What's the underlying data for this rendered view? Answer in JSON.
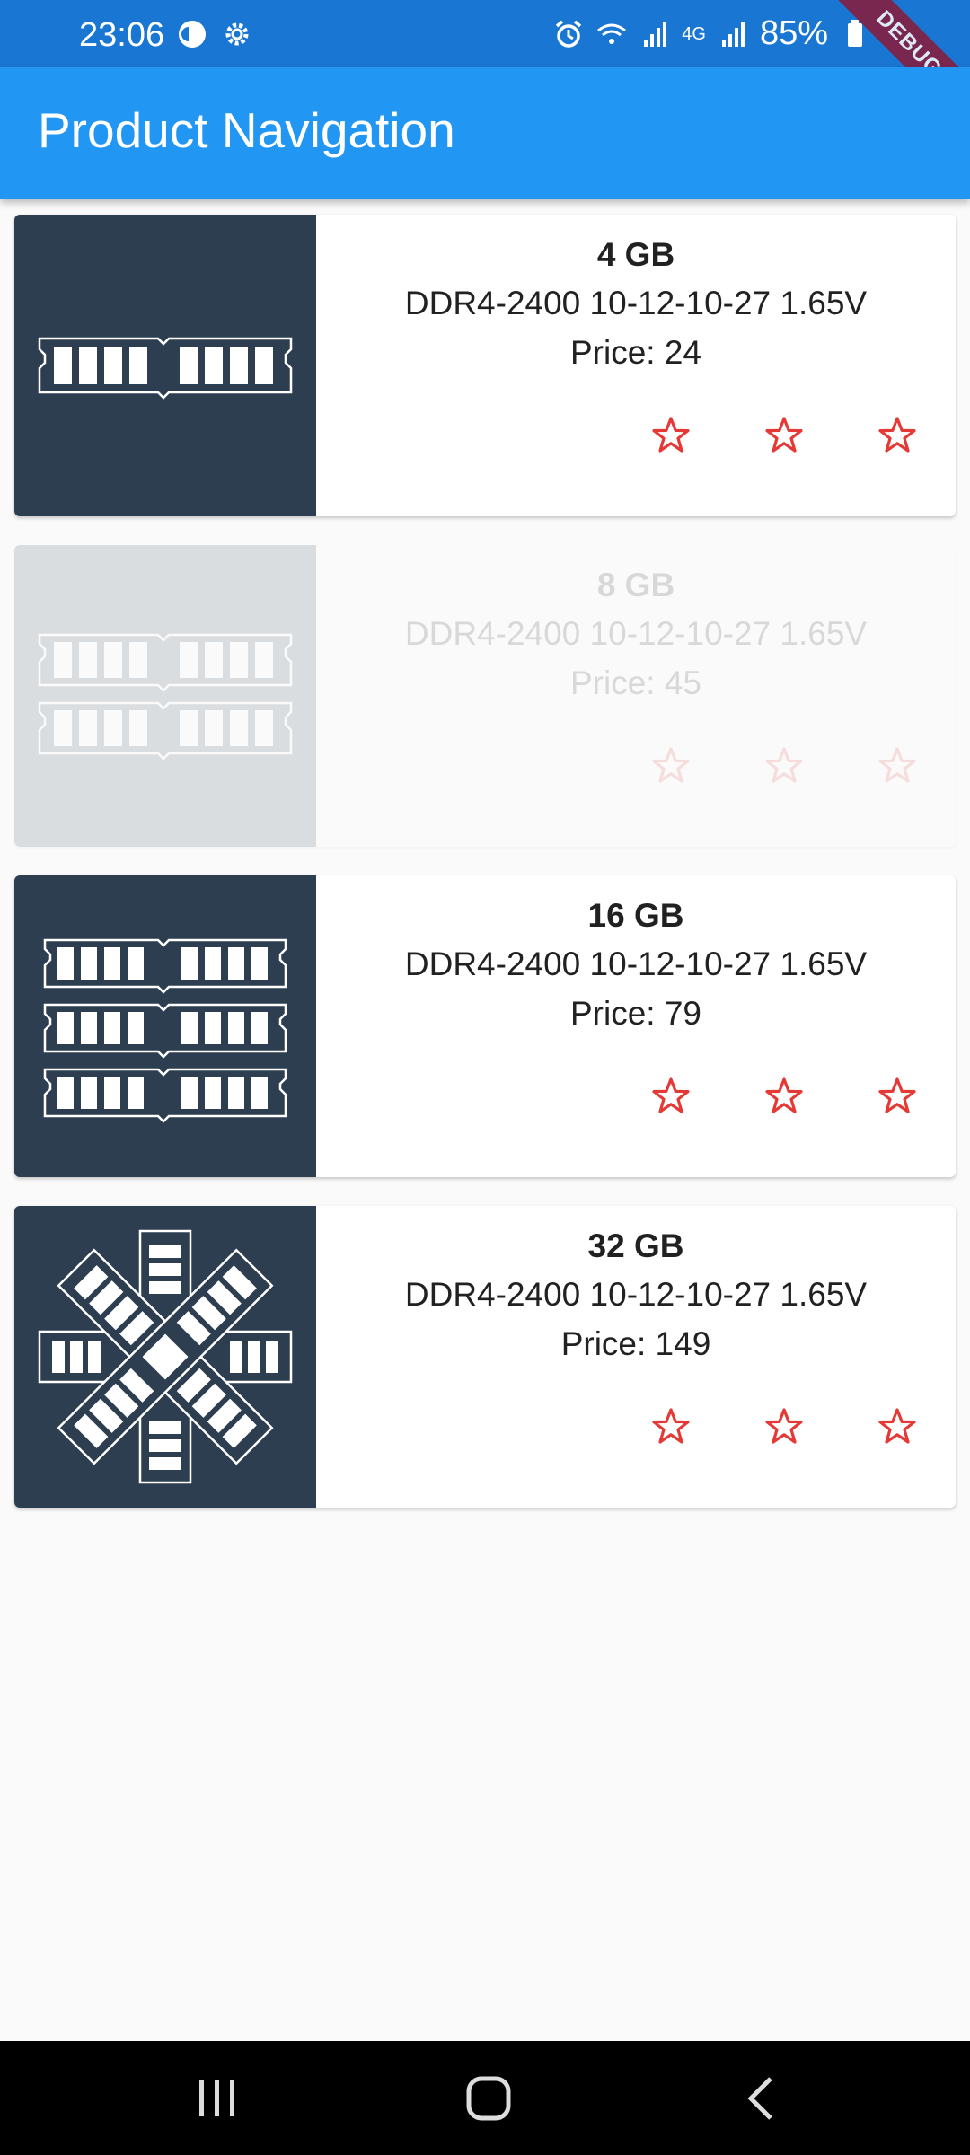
{
  "status": {
    "time": "23:06",
    "battery": "85%",
    "network": "4G",
    "debug_label": "DEBUG"
  },
  "app_bar": {
    "title": "Product Navigation"
  },
  "products": [
    {
      "capacity": "4 GB",
      "spec": "DDR4-2400 10-12-10-27 1.65V",
      "price": "Price: 24",
      "image": "single-ram-module-icon",
      "enabled": true,
      "rating_max": 3
    },
    {
      "capacity": "8 GB",
      "spec": "DDR4-2400 10-12-10-27 1.65V",
      "price": "Price: 45",
      "image": "double-ram-module-icon",
      "enabled": false,
      "rating_max": 3
    },
    {
      "capacity": "16 GB",
      "spec": "DDR4-2400 10-12-10-27 1.65V",
      "price": "Price: 79",
      "image": "triple-ram-module-icon",
      "enabled": true,
      "rating_max": 3
    },
    {
      "capacity": "32 GB",
      "spec": "DDR4-2400 10-12-10-27 1.65V",
      "price": "Price: 149",
      "image": "crossed-ram-modules-icon",
      "enabled": true,
      "rating_max": 3
    }
  ],
  "colors": {
    "status_bar": "#1976d2",
    "app_bar": "#2196f3",
    "thumb_bg": "#2d3e50",
    "star": "#e53935",
    "background": "#fafafa"
  }
}
